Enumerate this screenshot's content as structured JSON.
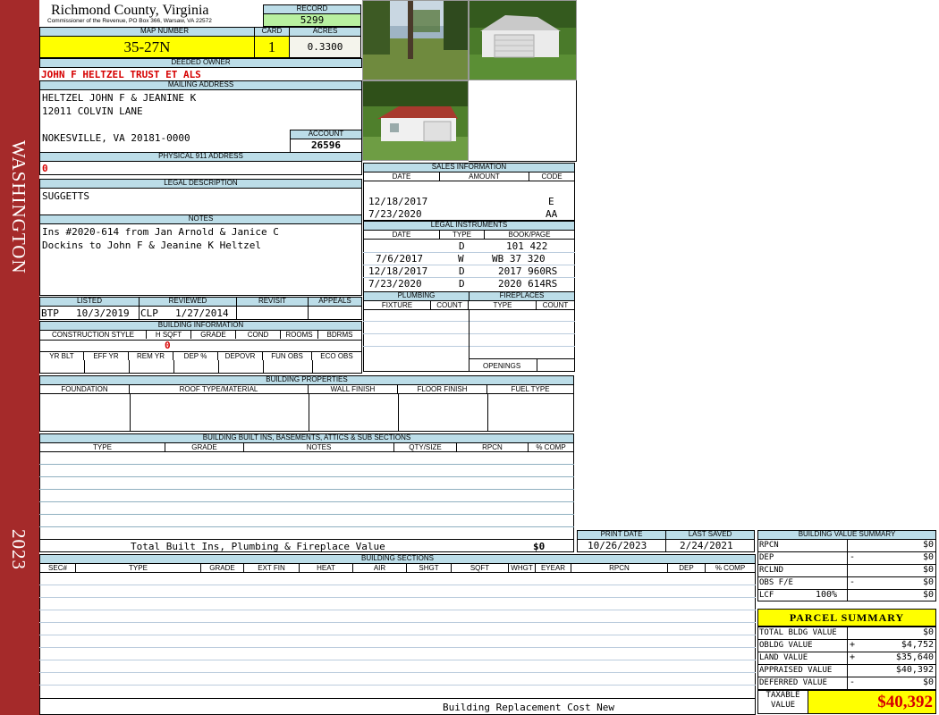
{
  "sidebar": {
    "top_text": "WASHINGTON",
    "bottom_text": "2023"
  },
  "header": {
    "county": "Richmond County, Virginia",
    "commissioner": "Commissioner of the Revenue, PO Box 366, Warsaw, VA 22572",
    "record_label": "RECORD",
    "record": "5299",
    "map_number_label": "MAP NUMBER",
    "map_number": "35-27N",
    "card_label": "CARD",
    "card": "1",
    "acres_label": "ACRES",
    "acres": "0.3300"
  },
  "owner": {
    "label": "DEEDED OWNER",
    "name": "JOHN F HELTZEL TRUST ET ALS"
  },
  "mailing": {
    "label": "MAILING ADDRESS",
    "line1": "HELTZEL JOHN F & JEANINE K",
    "line2": "12011 COLVIN LANE",
    "line3": "NOKESVILLE, VA 20181-0000",
    "account_label": "ACCOUNT",
    "account": "26596"
  },
  "physical": {
    "label": "PHYSICAL 911 ADDRESS",
    "value": "0"
  },
  "legal": {
    "label": "LEGAL DESCRIPTION",
    "value": "SUGGETTS"
  },
  "notes": {
    "label": "NOTES",
    "line1": "Ins #2020-614 from Jan Arnold & Janice C",
    "line2": "Dockins to John F & Jeanine K Heltzel"
  },
  "listed": {
    "listed_label": "LISTED",
    "reviewed_label": "REVIEWED",
    "revisit_label": "REVISIT",
    "appeals_label": "APPEALS",
    "listed_by": "BTP",
    "listed_date": "10/3/2019",
    "reviewed_by": "CLP",
    "reviewed_date": "1/27/2014"
  },
  "building_info": {
    "label": "BUILDING INFORMATION",
    "row1": [
      "CONSTRUCTION STYLE",
      "H SQFT",
      "GRADE",
      "COND",
      "ROOMS",
      "BDRMS"
    ],
    "row2": [
      "YR BLT",
      "EFF YR",
      "REM YR",
      "DEP %",
      "DEPOVR",
      "FUN OBS",
      "ECO OBS"
    ],
    "hsqft": "0"
  },
  "sales": {
    "label": "SALES INFORMATION",
    "cols": [
      "DATE",
      "AMOUNT",
      "CODE"
    ],
    "rows": [
      {
        "date": "12/18/2017",
        "amount": "",
        "code": "E"
      },
      {
        "date": "7/23/2020",
        "amount": "",
        "code": "AA"
      }
    ]
  },
  "legal_instruments": {
    "label": "LEGAL INSTRUMENTS",
    "cols": [
      "DATE",
      "TYPE",
      "BOOK/PAGE"
    ],
    "rows": [
      {
        "date": "",
        "type": "D",
        "book": "101 422"
      },
      {
        "date": "7/6/2017",
        "type": "W",
        "book": "WB 37 320"
      },
      {
        "date": "12/18/2017",
        "type": "D",
        "book": "2017 960RS"
      },
      {
        "date": "7/23/2020",
        "type": "D",
        "book": "2020 614RS"
      }
    ]
  },
  "plumbing": {
    "label": "PLUMBING",
    "cols": [
      "FIXTURE",
      "COUNT"
    ]
  },
  "fireplaces": {
    "label": "FIREPLACES",
    "cols": [
      "TYPE",
      "COUNT"
    ],
    "openings": "OPENINGS"
  },
  "building_properties": {
    "label": "BUILDING PROPERTIES",
    "cols": [
      "FOUNDATION",
      "ROOF TYPE/MATERIAL",
      "WALL FINISH",
      "FLOOR FINISH",
      "FUEL TYPE"
    ]
  },
  "built_ins": {
    "label": "BUILDING BUILT INS, BASEMENTS, ATTICS & SUB SECTIONS",
    "cols": [
      "TYPE",
      "GRADE",
      "NOTES",
      "QTY/SIZE",
      "RPCN",
      "% COMP"
    ],
    "total_label": "Total Built Ins, Plumbing & Fireplace Value",
    "total_value": "$0"
  },
  "print": {
    "print_label": "PRINT DATE",
    "print_date": "10/26/2023",
    "saved_label": "LAST SAVED",
    "saved_date": "2/24/2021"
  },
  "sections": {
    "label": "BUILDING SECTIONS",
    "cols": [
      "SEC#",
      "TYPE",
      "GRADE",
      "EXT FIN",
      "HEAT",
      "AIR",
      "SHGT",
      "SQFT",
      "WHGT",
      "EYEAR",
      "RPCN",
      "DEP",
      "% COMP"
    ],
    "footer": "Building Replacement Cost New"
  },
  "value_summary": {
    "label": "BUILDING VALUE SUMMARY",
    "rows": [
      {
        "label": "RPCN",
        "sign": "",
        "value": "$0"
      },
      {
        "label": "DEP",
        "sign": "-",
        "value": "$0"
      },
      {
        "label": "RCLND",
        "sign": "",
        "value": "$0"
      },
      {
        "label": "OBS F/E",
        "sign": "-",
        "value": "$0"
      },
      {
        "label": "LCF",
        "pct": "100%",
        "sign": "",
        "value": "$0"
      }
    ]
  },
  "parcel": {
    "label": "PARCEL SUMMARY",
    "rows": [
      {
        "label": "TOTAL BLDG VALUE",
        "sign": "",
        "value": "$0"
      },
      {
        "label": "OBLDG VALUE",
        "sign": "+",
        "value": "$4,752"
      },
      {
        "label": "LAND VALUE",
        "sign": "+",
        "value": "$35,640"
      },
      {
        "label": "APPRAISED VALUE",
        "sign": "",
        "value": "$40,392"
      },
      {
        "label": "DEFERRED VALUE",
        "sign": "-",
        "value": "$0"
      }
    ],
    "taxable_label1": "TAXABLE",
    "taxable_label2": "VALUE",
    "taxable": "$40,392"
  }
}
